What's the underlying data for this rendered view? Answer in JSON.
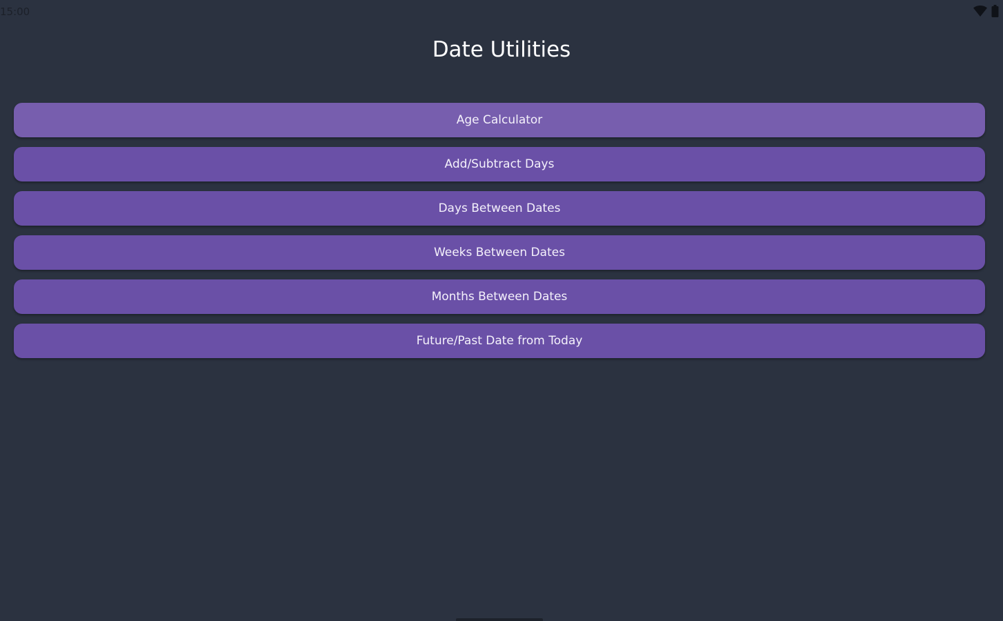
{
  "status_bar": {
    "time": "15:00",
    "wifi_icon": "wifi-icon",
    "battery_icon": "battery-icon"
  },
  "header": {
    "title": "Date Utilities"
  },
  "menu": {
    "items": [
      {
        "label": "Age Calculator"
      },
      {
        "label": "Add/Subtract Days"
      },
      {
        "label": "Days Between Dates"
      },
      {
        "label": "Weeks Between Dates"
      },
      {
        "label": "Months Between Dates"
      },
      {
        "label": "Future/Past Date from Today"
      }
    ]
  },
  "colors": {
    "background": "#2b3240",
    "button": "#6a50a7",
    "button_highlight": "#775eae",
    "text": "#ffffff"
  }
}
